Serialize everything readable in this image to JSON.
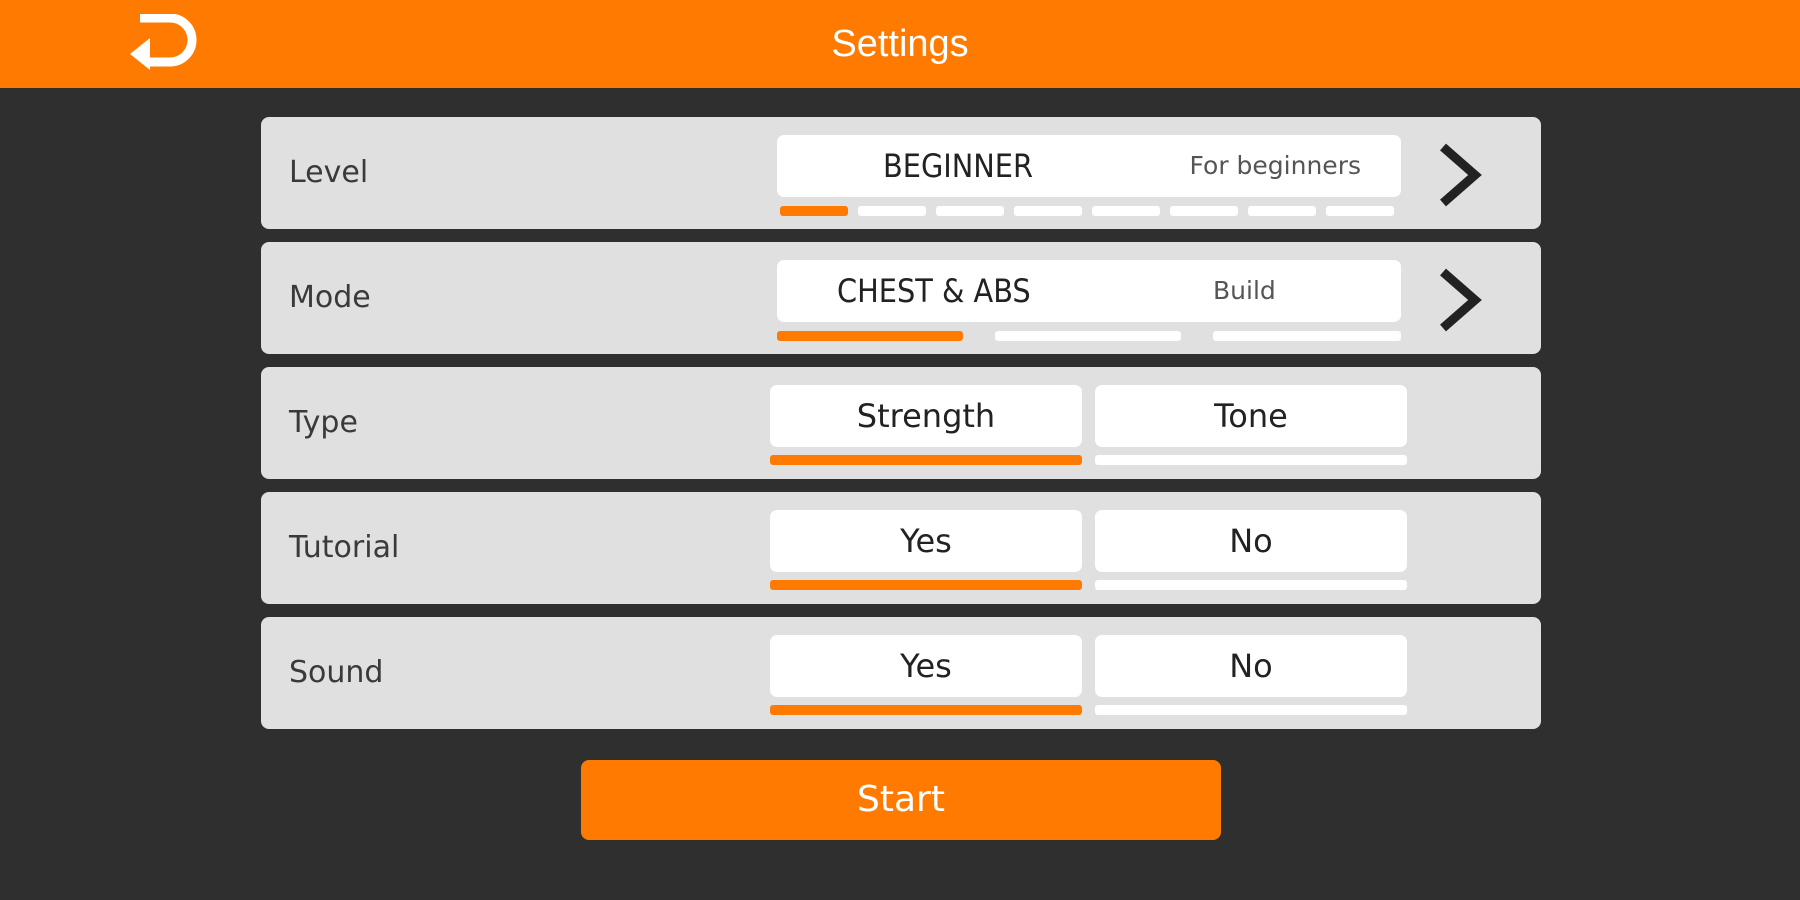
{
  "header": {
    "title": "Settings",
    "back_icon": "return-arrow-icon",
    "bg_color": "#ff7a00"
  },
  "rows": {
    "level": {
      "label": "Level",
      "value": "BEGINNER",
      "description": "For beginners",
      "step_selected": 1,
      "step_count": 8,
      "next_icon": "chevron-right-icon"
    },
    "mode": {
      "label": "Mode",
      "value": "CHEST & ABS",
      "description": "Build",
      "step_selected": 1,
      "step_count": 3,
      "next_icon": "chevron-right-icon"
    },
    "type": {
      "label": "Type",
      "options": [
        "Strength",
        "Tone"
      ],
      "selected": "Strength"
    },
    "tutorial": {
      "label": "Tutorial",
      "options": [
        "Yes",
        "No"
      ],
      "selected": "Yes"
    },
    "sound": {
      "label": "Sound",
      "options": [
        "Yes",
        "No"
      ],
      "selected": "Yes"
    }
  },
  "start_button": {
    "label": "Start"
  },
  "colors": {
    "accent": "#ff7a00",
    "background": "#2f2f2f",
    "panel": "#e0e0e0",
    "option": "#ffffff"
  }
}
